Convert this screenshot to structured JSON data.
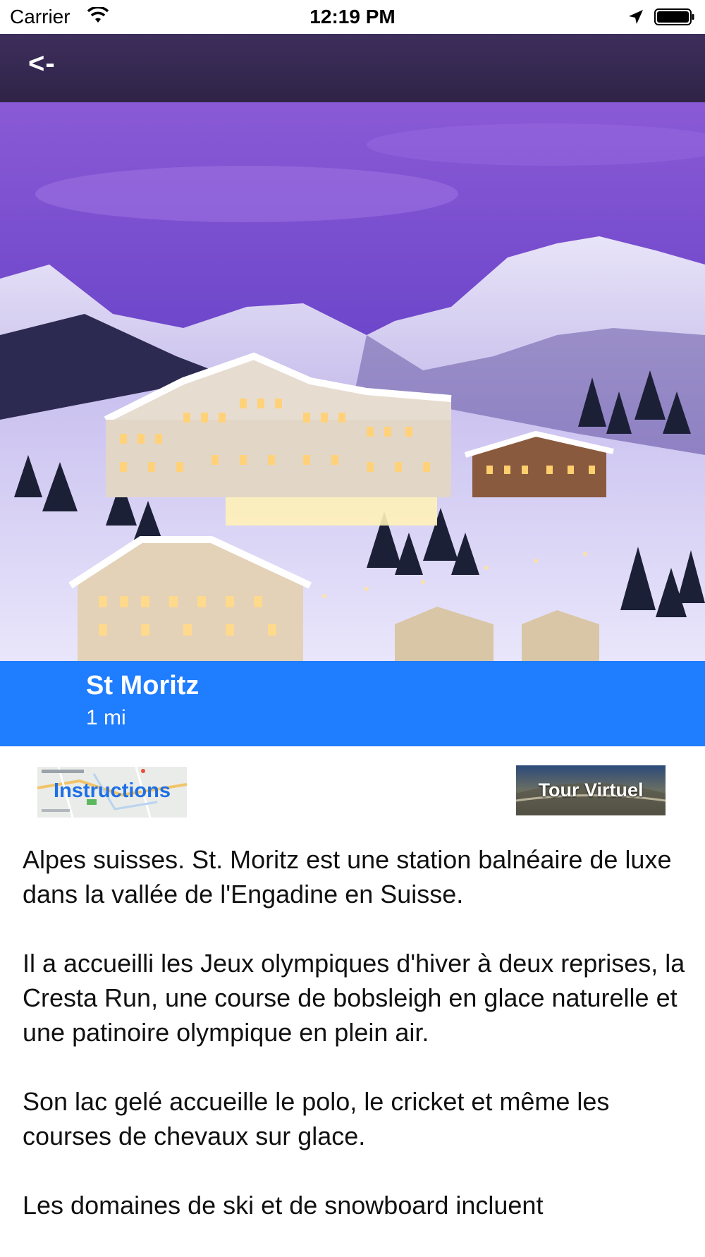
{
  "status_bar": {
    "carrier": "Carrier",
    "time": "12:19 PM",
    "icons": [
      "wifi-icon",
      "location-arrow-icon",
      "battery-icon"
    ]
  },
  "nav": {
    "back_label": "<-"
  },
  "hero": {
    "image": "st-moritz-winter-hotel-photo"
  },
  "place": {
    "name": "St Moritz",
    "distance": "1 mi"
  },
  "actions": {
    "instructions_label": "Instructions",
    "tour_label": "Tour Virtuel"
  },
  "description": {
    "paragraphs": [
      "Alpes suisses. St. Moritz est une station balnéaire de luxe dans la vallée de l'Engadine en Suisse.",
      "Il a accueilli les Jeux olympiques d'hiver à deux reprises, la Cresta Run, une course de bobsleigh en glace naturelle et une patinoire olympique en plein air.",
      "Son lac gelé accueille le polo, le cricket et même les courses de chevaux sur glace.",
      "Les domaines de ski et de snowboard incluent"
    ]
  },
  "colors": {
    "nav_bar": "#33274d",
    "title_band": "#1f7dff",
    "instructions_text": "#1e6fe6"
  }
}
